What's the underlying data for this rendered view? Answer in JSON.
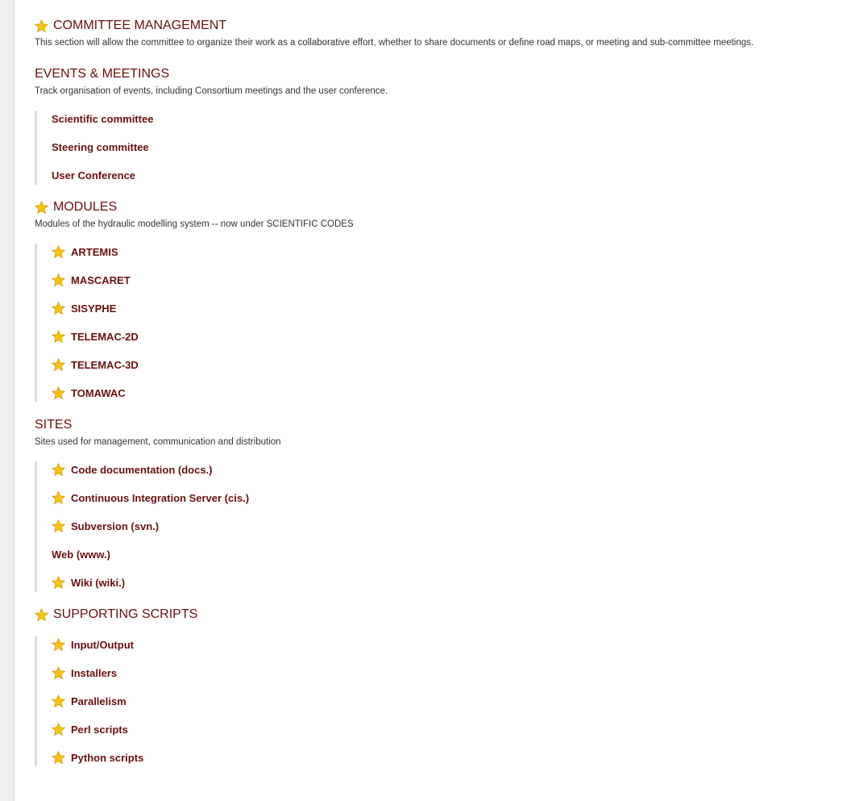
{
  "sections": [
    {
      "title": "COMMITTEE MANAGEMENT",
      "starred": true,
      "description": "This section will allow the committee to organize their work as a collaborative effort, whether to share documents or define road maps, or meeting and sub-committee meetings.",
      "items": []
    },
    {
      "title": "EVENTS & MEETINGS",
      "starred": false,
      "description": "Track organisation of events, including Consortium meetings and the user conference.",
      "items": [
        {
          "label": "Scientific committee",
          "starred": false
        },
        {
          "label": "Steering committee",
          "starred": false
        },
        {
          "label": "User Conference",
          "starred": false
        }
      ]
    },
    {
      "title": "MODULES",
      "starred": true,
      "description": "Modules of the hydraulic modelling system -- now under SCIENTIFIC CODES",
      "items": [
        {
          "label": "ARTEMIS",
          "starred": true
        },
        {
          "label": "MASCARET",
          "starred": true
        },
        {
          "label": "SISYPHE",
          "starred": true
        },
        {
          "label": "TELEMAC-2D",
          "starred": true
        },
        {
          "label": "TELEMAC-3D",
          "starred": true
        },
        {
          "label": "TOMAWAC",
          "starred": true
        }
      ]
    },
    {
      "title": "SITES",
      "starred": false,
      "description": "Sites used for management, communication and distribution",
      "items": [
        {
          "label": "Code documentation (docs.)",
          "starred": true
        },
        {
          "label": "Continuous Integration Server (cis.)",
          "starred": true
        },
        {
          "label": "Subversion (svn.)",
          "starred": true
        },
        {
          "label": "Web (www.)",
          "starred": false
        },
        {
          "label": "Wiki (wiki.)",
          "starred": true
        }
      ]
    },
    {
      "title": "SUPPORTING SCRIPTS",
      "starred": true,
      "description": "",
      "items": [
        {
          "label": "Input/Output",
          "starred": true
        },
        {
          "label": "Installers",
          "starred": true
        },
        {
          "label": "Parallelism",
          "starred": true
        },
        {
          "label": "Perl scripts",
          "starred": true
        },
        {
          "label": "Python scripts",
          "starred": true
        }
      ]
    }
  ],
  "colors": {
    "link": "#6a0f0f",
    "star": "#f5c518"
  },
  "icons": {
    "favorite": "star-icon"
  }
}
